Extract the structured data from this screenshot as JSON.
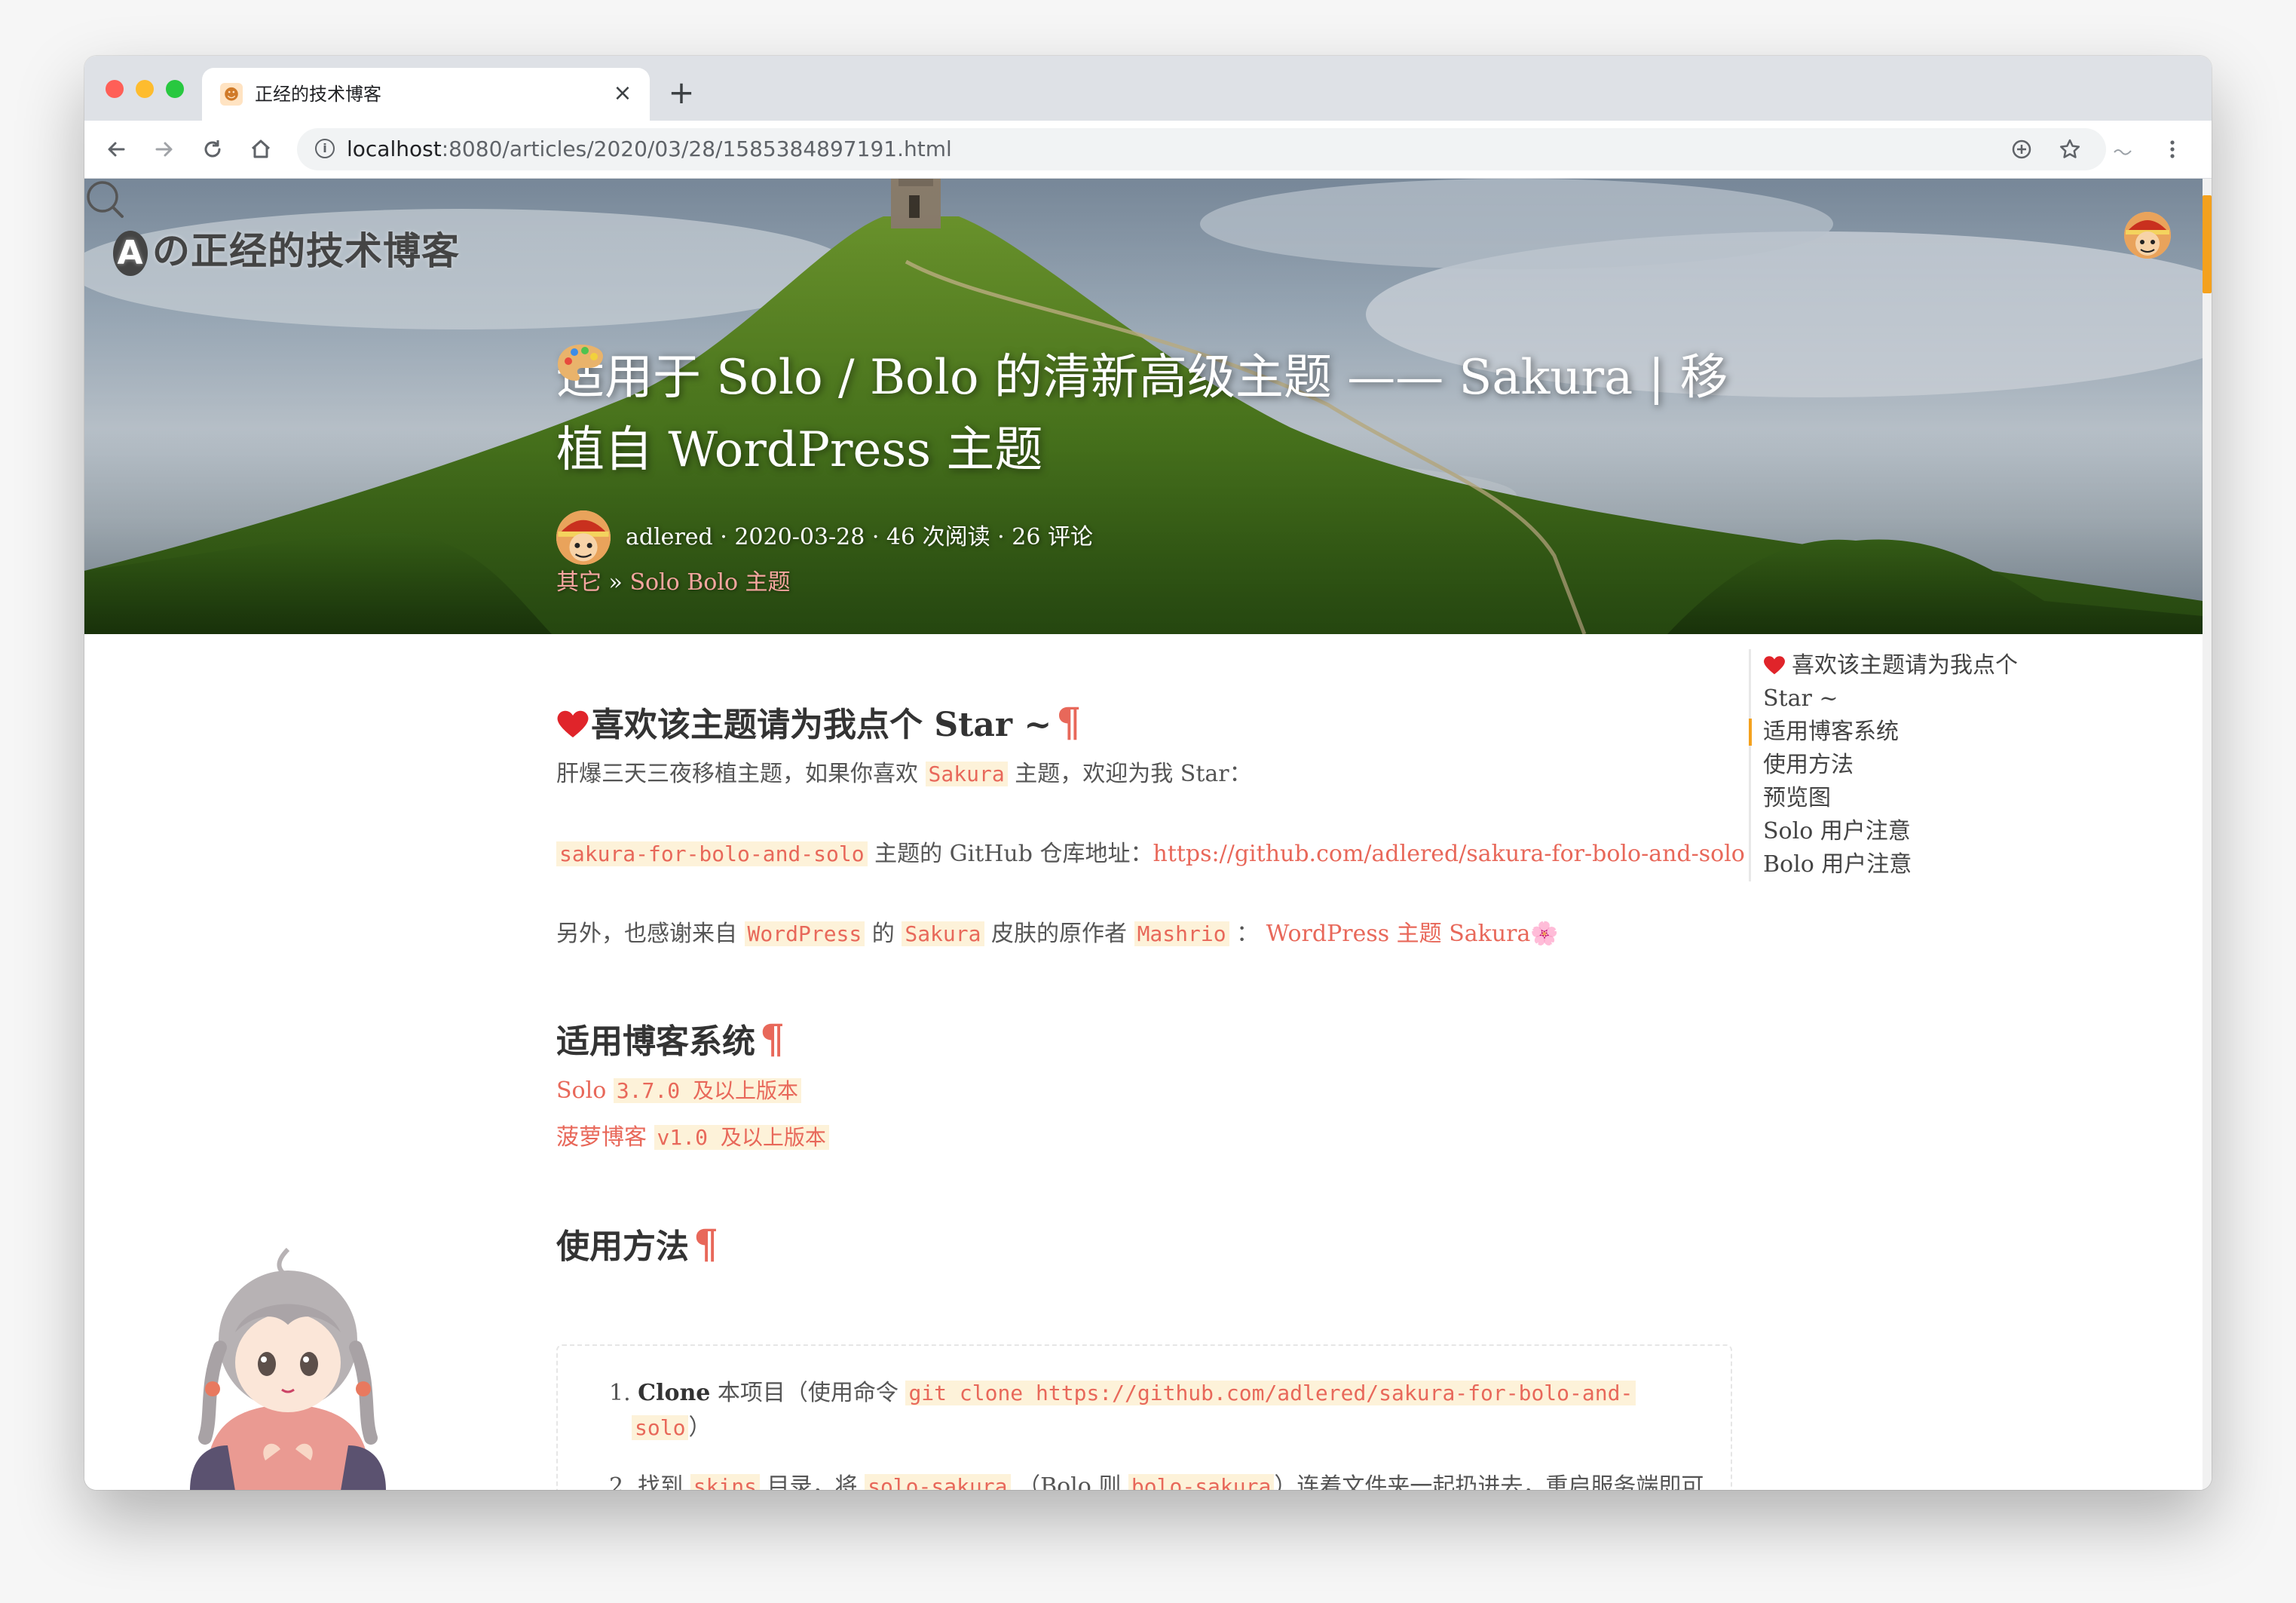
{
  "browser": {
    "tab_title": "正经的技术博客",
    "tab_close": "×",
    "new_tab": "+",
    "url_host": "localhost",
    "url_rest": ":8080/articles/2020/03/28/1585384897191.html"
  },
  "site": {
    "logo_mark": "A",
    "logo_text": "の正经的技术博客"
  },
  "post": {
    "title": "适用于 Solo / Bolo 的清新高级主题 —— Sakura | 移植自 WordPress 主题",
    "meta": "adlered · 2020-03-28 · 46 次阅读 · 26 评论",
    "category": "其它",
    "category_sep": " » ",
    "tags": "Solo Bolo 主题"
  },
  "article": {
    "sec1": {
      "title": "喜欢该主题请为我点个 Star ~",
      "pilcrow": "¶"
    },
    "p1": {
      "a": "肝爆三天三夜移植主题，如果你喜欢 ",
      "code": "Sakura",
      "b": " 主题，欢迎为我 Star："
    },
    "p2": {
      "code": "sakura-for-bolo-and-solo",
      "a": " 主题的 GitHub 仓库地址：",
      "link": "https://github.com/adlered/sakura-for-bolo-and-solo"
    },
    "p3": {
      "a": "另外，也感谢来自 ",
      "code1": "WordPress",
      "b": " 的 ",
      "code2": "Sakura",
      "c": " 皮肤的原作者 ",
      "code3": "Mashrio",
      "d": " ： ",
      "link": "WordPress 主题 Sakura",
      "flower": "🌸"
    },
    "sec2": {
      "title": "适用博客系统",
      "pilcrow": "¶"
    },
    "sys1": {
      "a": "Solo ",
      "code": "3.7.0 及以上版本"
    },
    "sys2": {
      "a": "菠萝博客 ",
      "code": "v1.0 及以上版本"
    },
    "sec3": {
      "title": "使用方法",
      "pilcrow": "¶"
    },
    "step1": {
      "num": "1.",
      "bold": "Clone",
      "a": " 本项目（使用命令 ",
      "code": "git clone https://github.com/adlered/sakura-for-bolo-and-",
      "code_cont": "solo",
      "b": "）"
    },
    "step2": {
      "num": "2.",
      "a": "找到 ",
      "code1": "skins",
      "b": " 目录，将 ",
      "code2": "solo-sakura",
      "c": " （Bolo 则 ",
      "code3": "bolo-sakura",
      "d": "）连着文件夹一起扔进去，重启服务端即可"
    }
  },
  "toc": {
    "items": [
      "喜欢该主题请为我点个",
      "Star ~",
      "适用博客系统",
      "使用方法",
      "预览图",
      "Solo 用户注意",
      "Bolo 用户注意"
    ],
    "active_index": 2
  },
  "colors": {
    "accent": "#e8685a",
    "scroll": "#f4a11d",
    "code_bg": "#fdf2d9"
  },
  "icons": [
    "back-icon",
    "forward-icon",
    "reload-icon",
    "home-icon",
    "info-icon",
    "add-icon",
    "star-icon",
    "extension-icon",
    "menu-icon",
    "search-icon",
    "heart-icon",
    "palette-icon"
  ]
}
